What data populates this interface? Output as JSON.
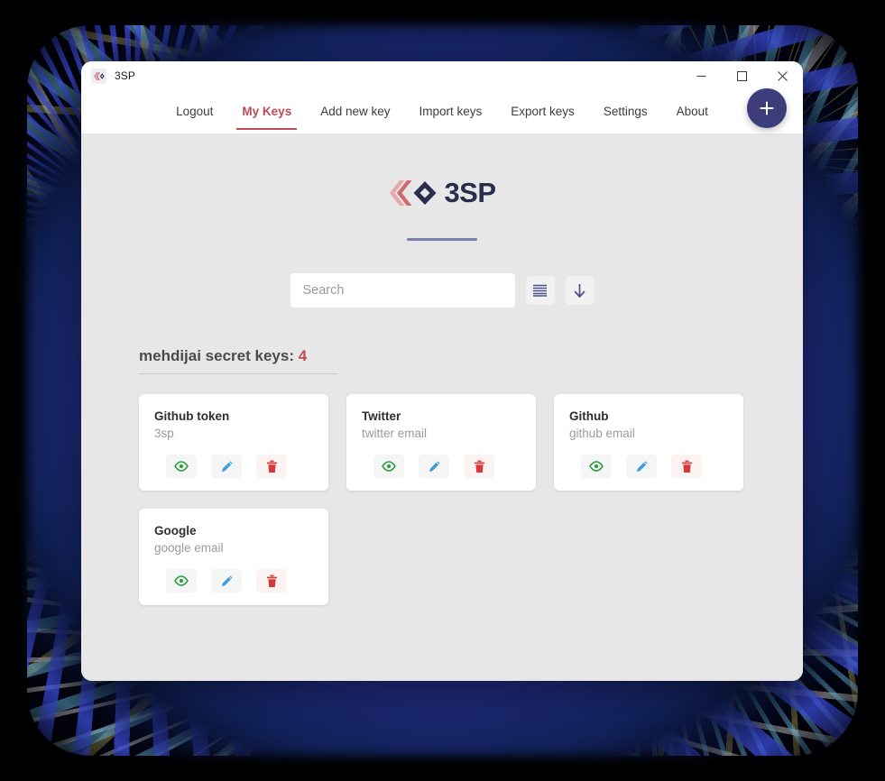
{
  "window": {
    "title": "3SP",
    "app_icon": "app-logo-icon",
    "controls": [
      {
        "name": "minimize-button",
        "glyph": "minimize-icon"
      },
      {
        "name": "maximize-button",
        "glyph": "maximize-icon"
      },
      {
        "name": "close-button",
        "glyph": "close-icon"
      }
    ]
  },
  "nav": {
    "items": [
      {
        "label": "Logout",
        "active": false
      },
      {
        "label": "My Keys",
        "active": true
      },
      {
        "label": "Add new key",
        "active": false
      },
      {
        "label": "Import keys",
        "active": false
      },
      {
        "label": "Export keys",
        "active": false
      },
      {
        "label": "Settings",
        "active": false
      },
      {
        "label": "About",
        "active": false
      }
    ],
    "active_color": "#bf4b55",
    "fab": {
      "icon": "plus-icon",
      "color": "#3c3d7a"
    }
  },
  "hero": {
    "logo_text": "3SP",
    "logo_icon": "3sp-logo-icon",
    "logo_colors": {
      "chevron_light": "#e3a3a6",
      "chevron_mid": "#d4777c",
      "chevron_dark": "#c4565c",
      "diamond": "#2b2d4e",
      "text": "#2b2d4e"
    },
    "divider_color": "#7b7fae"
  },
  "search": {
    "placeholder": "Search",
    "value": "",
    "list_button": {
      "icon": "list-view-icon"
    },
    "sort_button": {
      "icon": "arrow-down-icon"
    },
    "icon_color": "#4b4e8c"
  },
  "section": {
    "title_prefix": "mehdijai secret keys:",
    "count": "4"
  },
  "cards": [
    {
      "title": "Github token",
      "subtitle": "3sp"
    },
    {
      "title": "Twitter",
      "subtitle": "twitter email"
    },
    {
      "title": "Github",
      "subtitle": "github email"
    },
    {
      "title": "Google",
      "subtitle": "google email"
    }
  ],
  "card_actions": {
    "view": {
      "icon": "eye-icon",
      "color": "#2f9e44"
    },
    "edit": {
      "icon": "pencil-icon",
      "color": "#3b9ae1"
    },
    "delete": {
      "icon": "trash-icon",
      "color": "#d43a3a"
    }
  }
}
